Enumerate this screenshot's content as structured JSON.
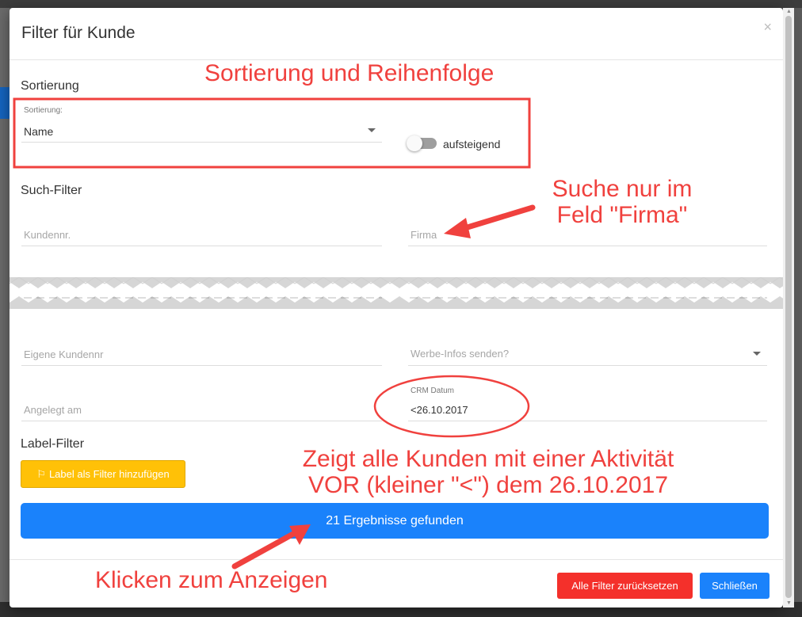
{
  "modal": {
    "title": "Filter für Kunde",
    "close": "×"
  },
  "sorting": {
    "heading": "Sortierung",
    "field_label": "Sortierung:",
    "field_value": "Name",
    "toggle_label": "aufsteigend",
    "toggle_on": false
  },
  "search_filter": {
    "heading": "Such-Filter",
    "kundennr_placeholder": "Kundennr.",
    "firma_placeholder": "Firma",
    "eigene_kundennr_placeholder": "Eigene Kundennr",
    "werbe_placeholder": "Werbe-Infos senden?",
    "angelegt_placeholder": "Angelegt am",
    "crm_label": "CRM Datum",
    "crm_value": "<26.10.2017"
  },
  "label_filter": {
    "heading": "Label-Filter",
    "add_button": "Label als Filter hinzufügen",
    "flag_icon": "⚐"
  },
  "results_button": "21 Ergebnisse gefunden",
  "footer": {
    "reset": "Alle Filter zurücksetzen",
    "close": "Schließen"
  },
  "annotations": {
    "sort": "Sortierung und Reihenfolge",
    "firma_line1": "Suche nur im",
    "firma_line2": "Feld \"Firma\"",
    "crm_line1": "Zeigt alle Kunden mit einer Aktivität",
    "crm_line2": "VOR (kleiner \"<\") dem 26.10.2017",
    "click": "Klicken zum Anzeigen"
  },
  "colors": {
    "annotation": "#f0413e",
    "primary": "#1a82fb",
    "warning": "#ffc107",
    "danger": "#f4302b"
  }
}
